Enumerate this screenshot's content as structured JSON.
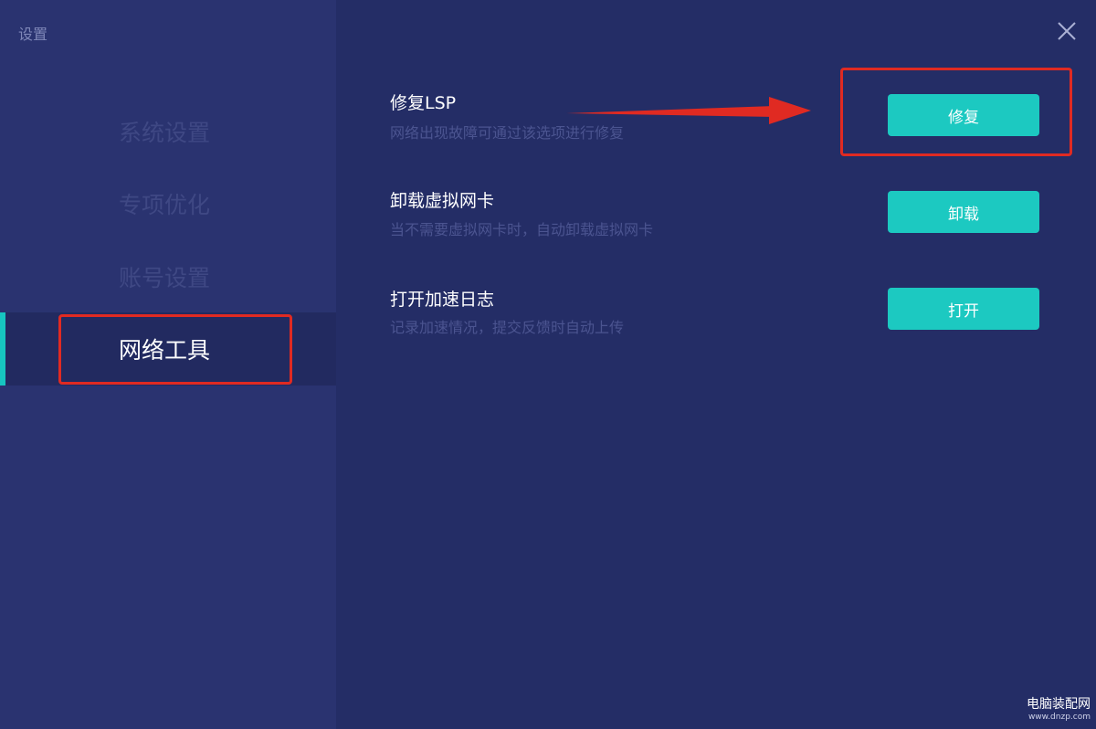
{
  "window": {
    "title": "设置",
    "close_icon": "close-icon"
  },
  "sidebar": {
    "items": [
      {
        "label": "系统设置",
        "active": false
      },
      {
        "label": "专项优化",
        "active": false
      },
      {
        "label": "账号设置",
        "active": false
      },
      {
        "label": "网络工具",
        "active": true
      }
    ]
  },
  "tools": [
    {
      "title": "修复LSP",
      "description": "网络出现故障可通过该选项进行修复",
      "button": "修复"
    },
    {
      "title": "卸载虚拟网卡",
      "description": "当不需要虚拟网卡时，自动卸载虚拟网卡",
      "button": "卸载"
    },
    {
      "title": "打开加速日志",
      "description": "记录加速情况，提交反馈时自动上传",
      "button": "打开"
    }
  ],
  "watermark": {
    "name": "电脑装配网",
    "url": "www.dnzp.com"
  },
  "colors": {
    "accent": "#1cc9c1",
    "annotation_red": "#e02a22",
    "background": "#242d66",
    "sidebar": "#2a3370"
  }
}
